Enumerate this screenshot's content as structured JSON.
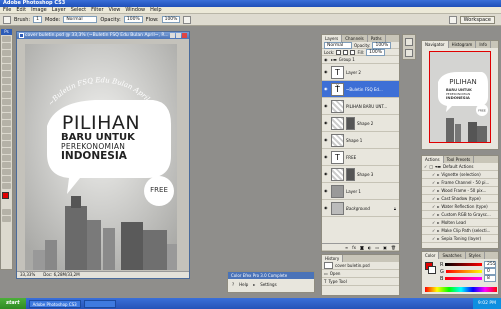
{
  "window": {
    "title": "Adobe Photoshop CS3"
  },
  "menu": [
    "File",
    "Edit",
    "Image",
    "Layer",
    "Select",
    "Filter",
    "View",
    "Window",
    "Help"
  ],
  "options": {
    "brush_label": "Brush:",
    "brush_size": "1",
    "mode_label": "Mode:",
    "mode_value": "Normal",
    "opacity_label": "Opacity:",
    "opacity_value": "100%",
    "flow_label": "Flow:",
    "flow_value": "100%",
    "workspace_label": "Workspace"
  },
  "document": {
    "title": "cover buletin.psd @ 33,3% (~Buletin FSQ Edu Bulan April~, R...",
    "zoom": "33,33%",
    "doc_size": "Doc: 6,28M/33,2M",
    "poster": {
      "arc_text": "~Buletin FSQ Edu Bulan April~",
      "line1": "PILIHAN",
      "line2": "BARU UNTUK",
      "line3": "PEREKONOMIAN",
      "line4": "INDONESIA",
      "badge": "FREE"
    }
  },
  "layers_panel": {
    "tabs": [
      "Layers",
      "Channels",
      "Paths"
    ],
    "blend_mode": "Normal",
    "opacity_label": "Opacity:",
    "opacity_value": "100%",
    "lock_label": "Lock:",
    "fill_label": "Fill:",
    "fill_value": "100%",
    "layers": [
      {
        "name": "Group 1",
        "kind": "group",
        "selected": false
      },
      {
        "name": "Layer 2",
        "kind": "text",
        "selected": false
      },
      {
        "name": "~Buletin FSQ Ed...",
        "kind": "text",
        "selected": true
      },
      {
        "name": "PILIHAN BARU UNT...",
        "kind": "image",
        "selected": false
      },
      {
        "name": "Shape 2",
        "kind": "shape",
        "selected": false
      },
      {
        "name": "Shape 1",
        "kind": "shape",
        "selected": false
      },
      {
        "name": "FREE",
        "kind": "text",
        "selected": false
      },
      {
        "name": "Shape 3",
        "kind": "shape",
        "selected": false
      },
      {
        "name": "Layer 1",
        "kind": "image",
        "selected": false
      },
      {
        "name": "Background",
        "kind": "image",
        "selected": false
      }
    ]
  },
  "navigator_panel": {
    "tabs": [
      "Navigator",
      "Histogram",
      "Info"
    ],
    "zoom": "33,33%"
  },
  "actions_panel": {
    "tabs": [
      "Actions",
      "Tool Presets"
    ],
    "items": [
      "Default Actions",
      "Vignette (selection)",
      "Frame Channel - 50 pi...",
      "Wood Frame - 50 pix...",
      "Cast Shadow (type)",
      "Water Reflection (type)",
      "Custom RGB to Graysc...",
      "Molten Lead",
      "Make Clip Path (selecti...",
      "Sepia Toning (layer)"
    ]
  },
  "color_panel": {
    "tabs": [
      "Color",
      "Swatches",
      "Styles"
    ],
    "r": "255",
    "g": "0",
    "b": "8",
    "r_label": "R",
    "g_label": "G",
    "b_label": "B"
  },
  "history_panel": {
    "tabs": [
      "History"
    ],
    "items": [
      "cover buletin.psd",
      "Open",
      "Type Tool"
    ]
  },
  "floating": {
    "title": "Color Efex Pro 3.0 Complete",
    "help": "Help",
    "settings": "Settings"
  },
  "taskbar": {
    "start": "start",
    "tasks": [
      "Adobe Photoshop CS3"
    ],
    "time": "9:02 PM"
  },
  "colors": {
    "accent": "#3d6fd6",
    "foreground": "#e00000",
    "background": "#ffffff"
  }
}
